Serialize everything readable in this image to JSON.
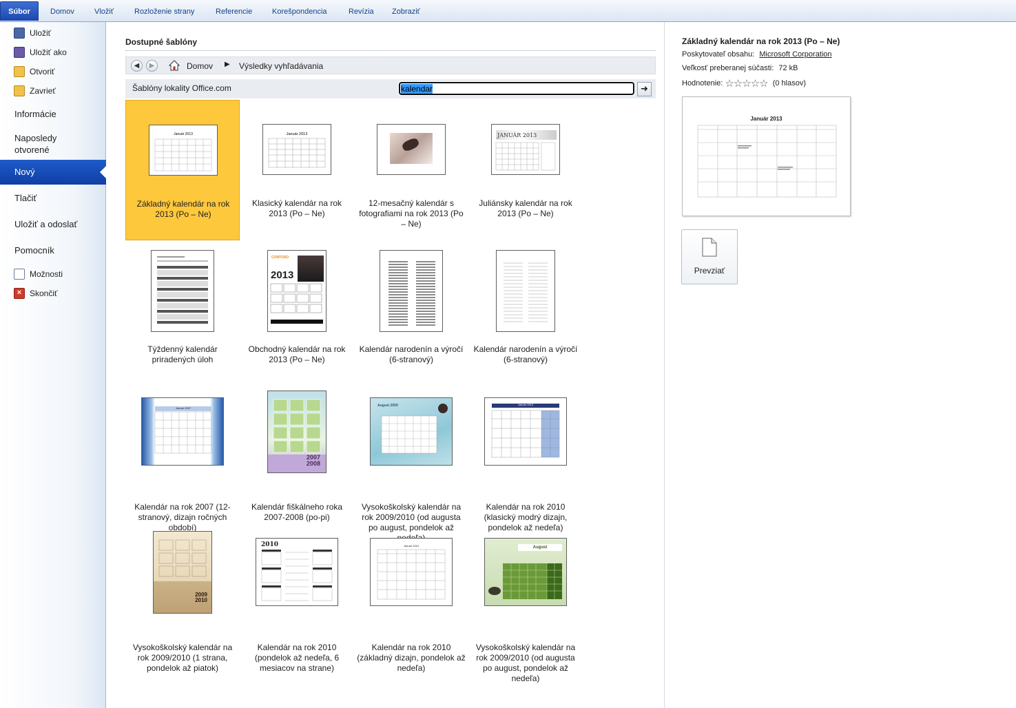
{
  "ribbon": {
    "tabs": [
      "Súbor",
      "Domov",
      "Vložiť",
      "Rozloženie strany",
      "Referencie",
      "Korešpondencia",
      "Revízia",
      "Zobraziť"
    ]
  },
  "backstage": {
    "commands": [
      "Uložiť",
      "Uložiť ako",
      "Otvoriť",
      "Zavrieť"
    ],
    "tabs": [
      "Informácie",
      "Naposledy otvorené",
      "Nový",
      "Tlačiť",
      "Uložiť a odoslať",
      "Pomocník"
    ],
    "bottom_commands": [
      "Možnosti",
      "Skončiť"
    ],
    "active_tab": "Nový"
  },
  "main": {
    "heading": "Dostupné šablóny",
    "breadcrumb": {
      "home": "Domov",
      "current": "Výsledky vyhľadávania"
    },
    "search": {
      "label": "Šablóny lokality Office.com",
      "value": "kalendar"
    },
    "templates": [
      {
        "label": "Základný kalendár na rok 2013 (Po – Ne)",
        "selected": true
      },
      {
        "label": "Klasický kalendár na rok 2013 (Po – Ne)"
      },
      {
        "label": "12-mesačný kalendár s fotografiami na rok 2013 (Po – Ne)"
      },
      {
        "label": "Juliánsky kalendár na rok 2013 (Po – Ne)"
      },
      {
        "label": "Týždenný kalendár priradených úloh"
      },
      {
        "label": "Obchodný kalendár na rok 2013 (Po – Ne)"
      },
      {
        "label": "Kalendár narodenín a výročí (6-stranový)"
      },
      {
        "label": "Kalendár narodenín a výročí (6-stranový)"
      },
      {
        "label": "Kalendár na rok 2007 (12-stranový, dizajn ročných období)"
      },
      {
        "label": "Kalendár fiškálneho roka 2007-2008 (po-pi)"
      },
      {
        "label": "Vysokoškolský kalendár na rok 2009/2010 (od augusta po august, pondelok až nedeľa)"
      },
      {
        "label": "Kalendár na rok 2010 (klasický modrý dizajn, pondelok až nedeľa)"
      },
      {
        "label": "Vysokoškolský kalendár na rok 2009/2010 (1 strana, pondelok až piatok)"
      },
      {
        "label": "Kalendár na rok 2010 (pondelok až nedeľa, 6 mesiacov na strane)"
      },
      {
        "label": "Kalendár na rok 2010 (základný dizajn, pondelok až nedeľa)"
      },
      {
        "label": "Vysokoškolský kalendár na rok 2009/2010 (od augusta po august, pondelok až nedeľa)"
      }
    ]
  },
  "details": {
    "title": "Základný kalendár na rok 2013 (Po – Ne)",
    "provider_label": "Poskytovateľ obsahu:",
    "provider": "Microsoft Corporation",
    "size_label": "Veľkosť preberanej súčasti:",
    "size": "72 kB",
    "rating_label": "Hodnotenie:",
    "rating_stars": 0,
    "rating_votes": "(0 hlasov)",
    "preview_title": "Január 2013",
    "download_label": "Prevziať"
  },
  "colors": {
    "selected": "#fec83c",
    "nav_active": "#1e5ac8",
    "ribbon_file": "#2a5bc4"
  },
  "thumb_text": {
    "t1": "Január 2013",
    "t2": "Január 2013",
    "t4": "JANUÁR 2013",
    "t6": "2013",
    "t6_brand": "CONTOSO",
    "t9": "Január 2007",
    "t10a": "2007",
    "t10b": "2008",
    "t11": "August 2009",
    "t12": "Január 2010",
    "t13a": "2009",
    "t13b": "2010",
    "t14": "2010",
    "t15": "Január 2010",
    "t16": "August"
  }
}
